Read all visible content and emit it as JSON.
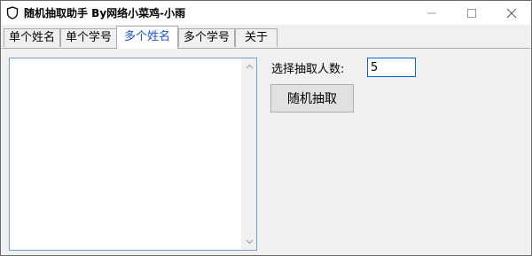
{
  "window": {
    "title": "随机抽取助手  By网络小菜鸡-小雨",
    "icon": "shield-icon"
  },
  "tabs": [
    {
      "label": "单个姓名",
      "active": false
    },
    {
      "label": "单个学号",
      "active": false
    },
    {
      "label": "多个姓名",
      "active": true
    },
    {
      "label": "多个学号",
      "active": false
    },
    {
      "label": "关于",
      "active": false
    }
  ],
  "main": {
    "count_label": "选择抽取人数:",
    "count_value": "5",
    "pick_button_label": "随机抽取",
    "results_list": []
  },
  "colors": {
    "active_tab_text": "#1a56c9",
    "input_border": "#0a64d6",
    "list_border": "#7a9cd3"
  }
}
